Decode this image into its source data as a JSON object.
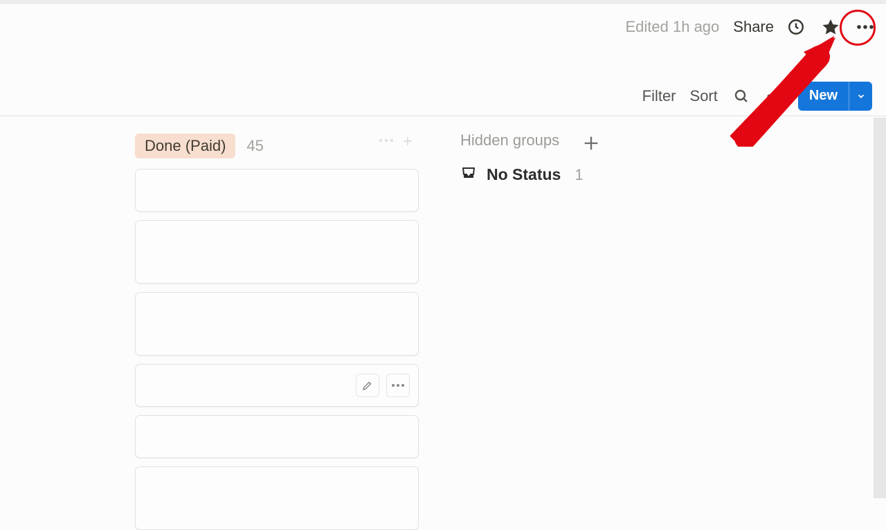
{
  "header": {
    "edited_status": "Edited 1h ago",
    "share_label": "Share"
  },
  "toolbar": {
    "filter_label": "Filter",
    "sort_label": "Sort",
    "new_label": "New"
  },
  "column": {
    "title": "Done (Paid)",
    "count": "45"
  },
  "hidden_groups": {
    "title": "Hidden groups",
    "items": [
      {
        "label": "No Status",
        "count": "1"
      }
    ]
  }
}
